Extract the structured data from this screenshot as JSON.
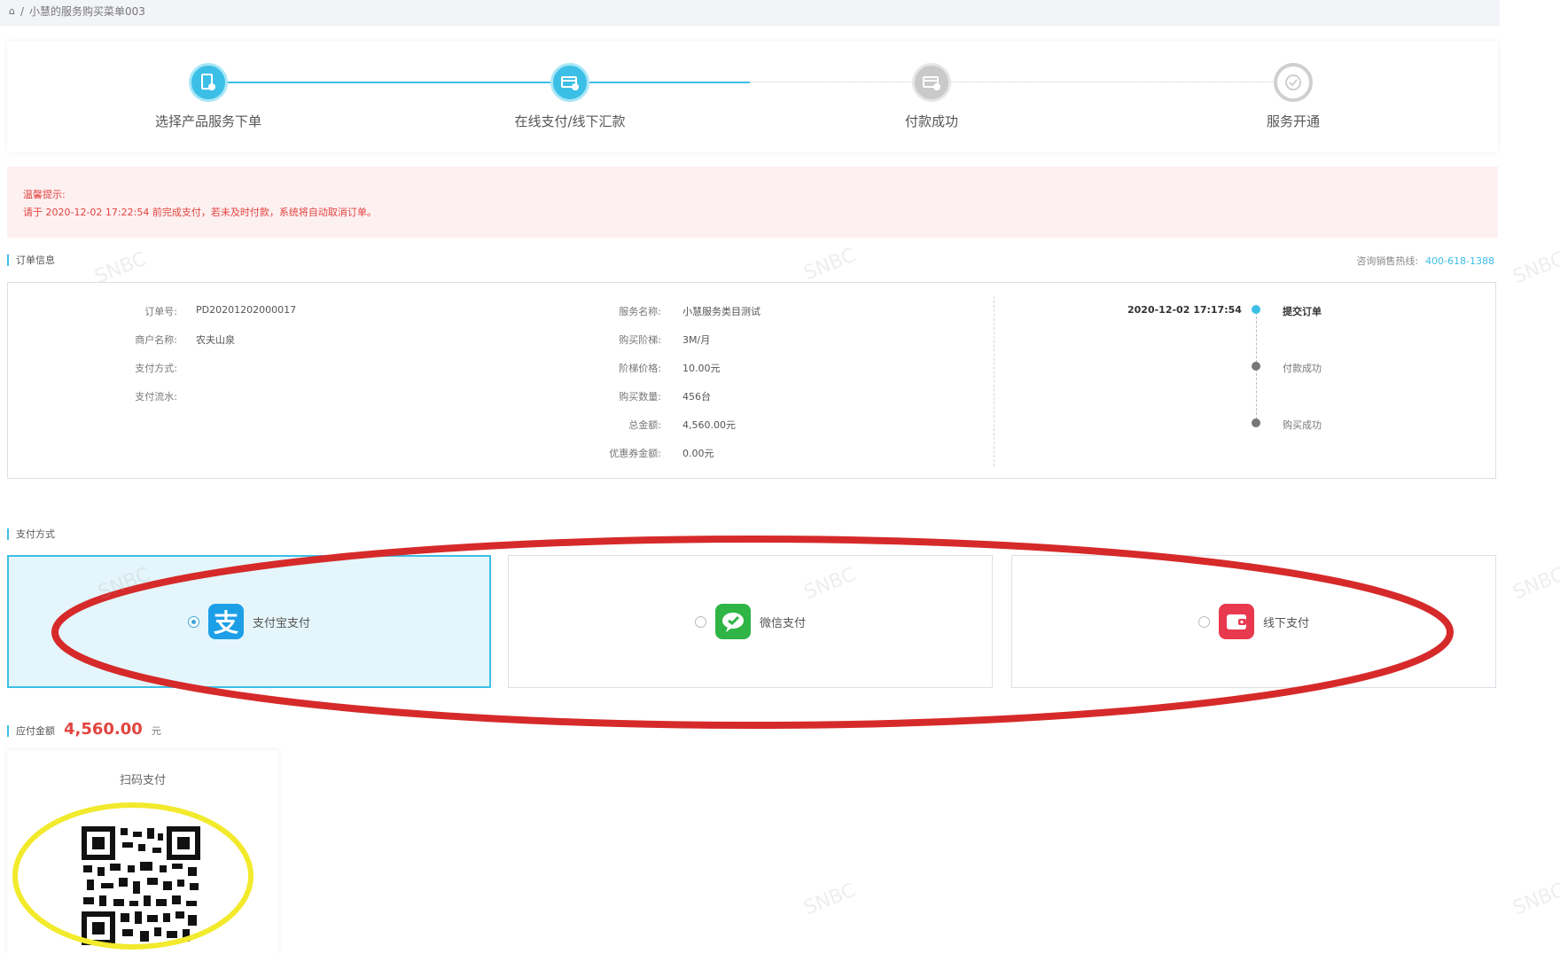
{
  "breadcrumb": {
    "home_icon": "home-icon",
    "separator": "/",
    "current": "小慧的服务购买菜单003"
  },
  "steps": [
    {
      "label": "选择产品服务下单",
      "icon": "order-doc-icon",
      "state": "done"
    },
    {
      "label": "在线支付/线下汇款",
      "icon": "payment-card-icon",
      "state": "done"
    },
    {
      "label": "付款成功",
      "icon": "payment-card-icon",
      "state": "todo"
    },
    {
      "label": "服务开通",
      "icon": "check-circle-icon",
      "state": "todo"
    }
  ],
  "alert": {
    "title": "温馨提示:",
    "message": "请于 2020-12-02 17:22:54 前完成支付，若未及时付款，系统将自动取消订单。"
  },
  "order_section": {
    "title": "订单信息",
    "hotline_label": "咨询销售热线:",
    "hotline_number": "400-618-1388"
  },
  "order_info": {
    "left": [
      {
        "label": "订单号:",
        "value": "PD20201202000017"
      },
      {
        "label": "商户名称:",
        "value": "农夫山泉"
      },
      {
        "label": "支付方式:",
        "value": ""
      },
      {
        "label": "支付流水:",
        "value": ""
      }
    ],
    "middle": [
      {
        "label": "服务名称:",
        "value": "小慧服务类目测试"
      },
      {
        "label": "购买阶梯:",
        "value": "3M/月"
      },
      {
        "label": "阶梯价格:",
        "value": "10.00元"
      },
      {
        "label": "购买数量:",
        "value": "456台"
      },
      {
        "label": "总金额:",
        "value": "4,560.00元"
      },
      {
        "label": "优惠券金额:",
        "value": "0.00元"
      }
    ],
    "timeline": [
      {
        "time": "2020-12-02 17:17:54",
        "text": "提交订单",
        "active": true
      },
      {
        "time": "",
        "text": "付款成功",
        "active": false
      },
      {
        "time": "",
        "text": "购买成功",
        "active": false
      }
    ]
  },
  "payment_section": {
    "title": "支付方式"
  },
  "payment_methods": [
    {
      "label": "支付宝支付",
      "icon": "alipay-icon",
      "color": "#1d9fe8",
      "selected": true
    },
    {
      "label": "微信支付",
      "icon": "wechat-icon",
      "color": "#2fb545",
      "selected": false
    },
    {
      "label": "线下支付",
      "icon": "wallet-icon",
      "color": "#e8394f",
      "selected": false
    }
  ],
  "amount": {
    "label": "应付金额",
    "value": "4,560.00",
    "unit": "元"
  },
  "qr": {
    "title": "扫码支付"
  },
  "watermark": "SNBC",
  "colors": {
    "accent": "#3cbfe6",
    "danger": "#e2443f",
    "annotation_red": "#d62a2a",
    "annotation_yellow": "#f2ea2c"
  }
}
